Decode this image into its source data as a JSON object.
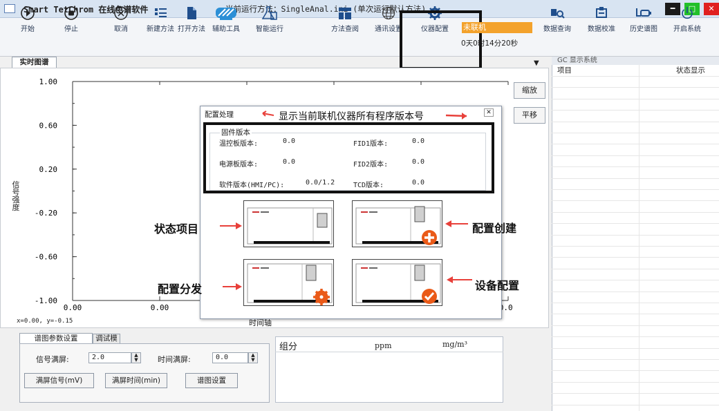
{
  "app": {
    "title": "Smart TetChrom 在线色谱软件",
    "method": "当前运行方法：SingleAnal.ini (单次运行默认方法)"
  },
  "toolbar": {
    "items": [
      {
        "label": "开始",
        "icon": "play-icon"
      },
      {
        "label": "停止",
        "icon": "stop-icon"
      },
      {
        "label": "取消",
        "icon": "cancel-icon"
      },
      {
        "label": "新建方法",
        "icon": "new-method-icon"
      },
      {
        "label": "打开方法",
        "icon": "open-method-icon"
      },
      {
        "label": "辅助工具",
        "icon": "tools-icon"
      },
      {
        "label": "智能运行",
        "icon": "flask-icon"
      },
      {
        "label": "方法查阅",
        "icon": "method-lookup-icon"
      },
      {
        "label": "通讯设置",
        "icon": "globe-icon"
      },
      {
        "label": "仪器配置",
        "icon": "gear-icon"
      },
      {
        "label": "数据查询",
        "icon": "data-query-icon"
      },
      {
        "label": "数据校准",
        "icon": "calibrate-icon"
      },
      {
        "label": "历史谱图",
        "icon": "history-icon"
      },
      {
        "label": "开启系统",
        "icon": "power-icon"
      }
    ],
    "connection_status": "未联机",
    "uptime": "0天0时14分20秒",
    "accent": "#f3a22c"
  },
  "tabs": {
    "realtime": "实时图谱"
  },
  "chart": {
    "side_buttons": [
      "缩放",
      "平移"
    ],
    "coord_readout": "x=0.00, y=-0.15"
  },
  "chart_data": {
    "type": "line",
    "title": "",
    "xlabel": "时间轴",
    "ylabel": "信号强度",
    "y_ticks": [
      "1.00",
      "0.60",
      "0.20",
      "-0.20",
      "-0.60",
      "-1.00"
    ],
    "x_ticks": [
      "0.00",
      "0.00",
      "0.00"
    ],
    "ylim": [
      -1.0,
      1.0
    ],
    "series": []
  },
  "gc_panel": {
    "header": "GC 显示系统",
    "columns": [
      "项目",
      "状态显示"
    ]
  },
  "dialog": {
    "title": "配置处理",
    "annotation": "显示当前联机仪器所有程序版本号",
    "firmware_legend": "固件版本",
    "rows": [
      {
        "l_label": "温控板版本:",
        "l_value": "0.0",
        "r_label": "FID1版本:",
        "r_value": "0.0"
      },
      {
        "l_label": "电源板版本:",
        "l_value": "0.0",
        "r_label": "FID2版本:",
        "r_value": "0.0"
      },
      {
        "l_label": "软件版本(HMI/PC):",
        "l_value": "0.0/1.2",
        "r_label": "TCD版本:",
        "r_value": "0.0"
      }
    ],
    "callouts": {
      "status": "状态项目",
      "create": "配置创建",
      "distribute": "配置分发",
      "device": "设备配置"
    }
  },
  "bottom": {
    "tabs": [
      "谱图参数设置",
      "调试模式"
    ],
    "signal_label": "信号满屏:",
    "signal_value": "2.0",
    "time_label": "时间满屏:",
    "time_value": "0.0",
    "buttons": [
      "满屏信号(mV)",
      "满屏时间(min)",
      "谱图设置"
    ],
    "table_columns": [
      "组分",
      "ppm",
      "mg/m³"
    ]
  }
}
